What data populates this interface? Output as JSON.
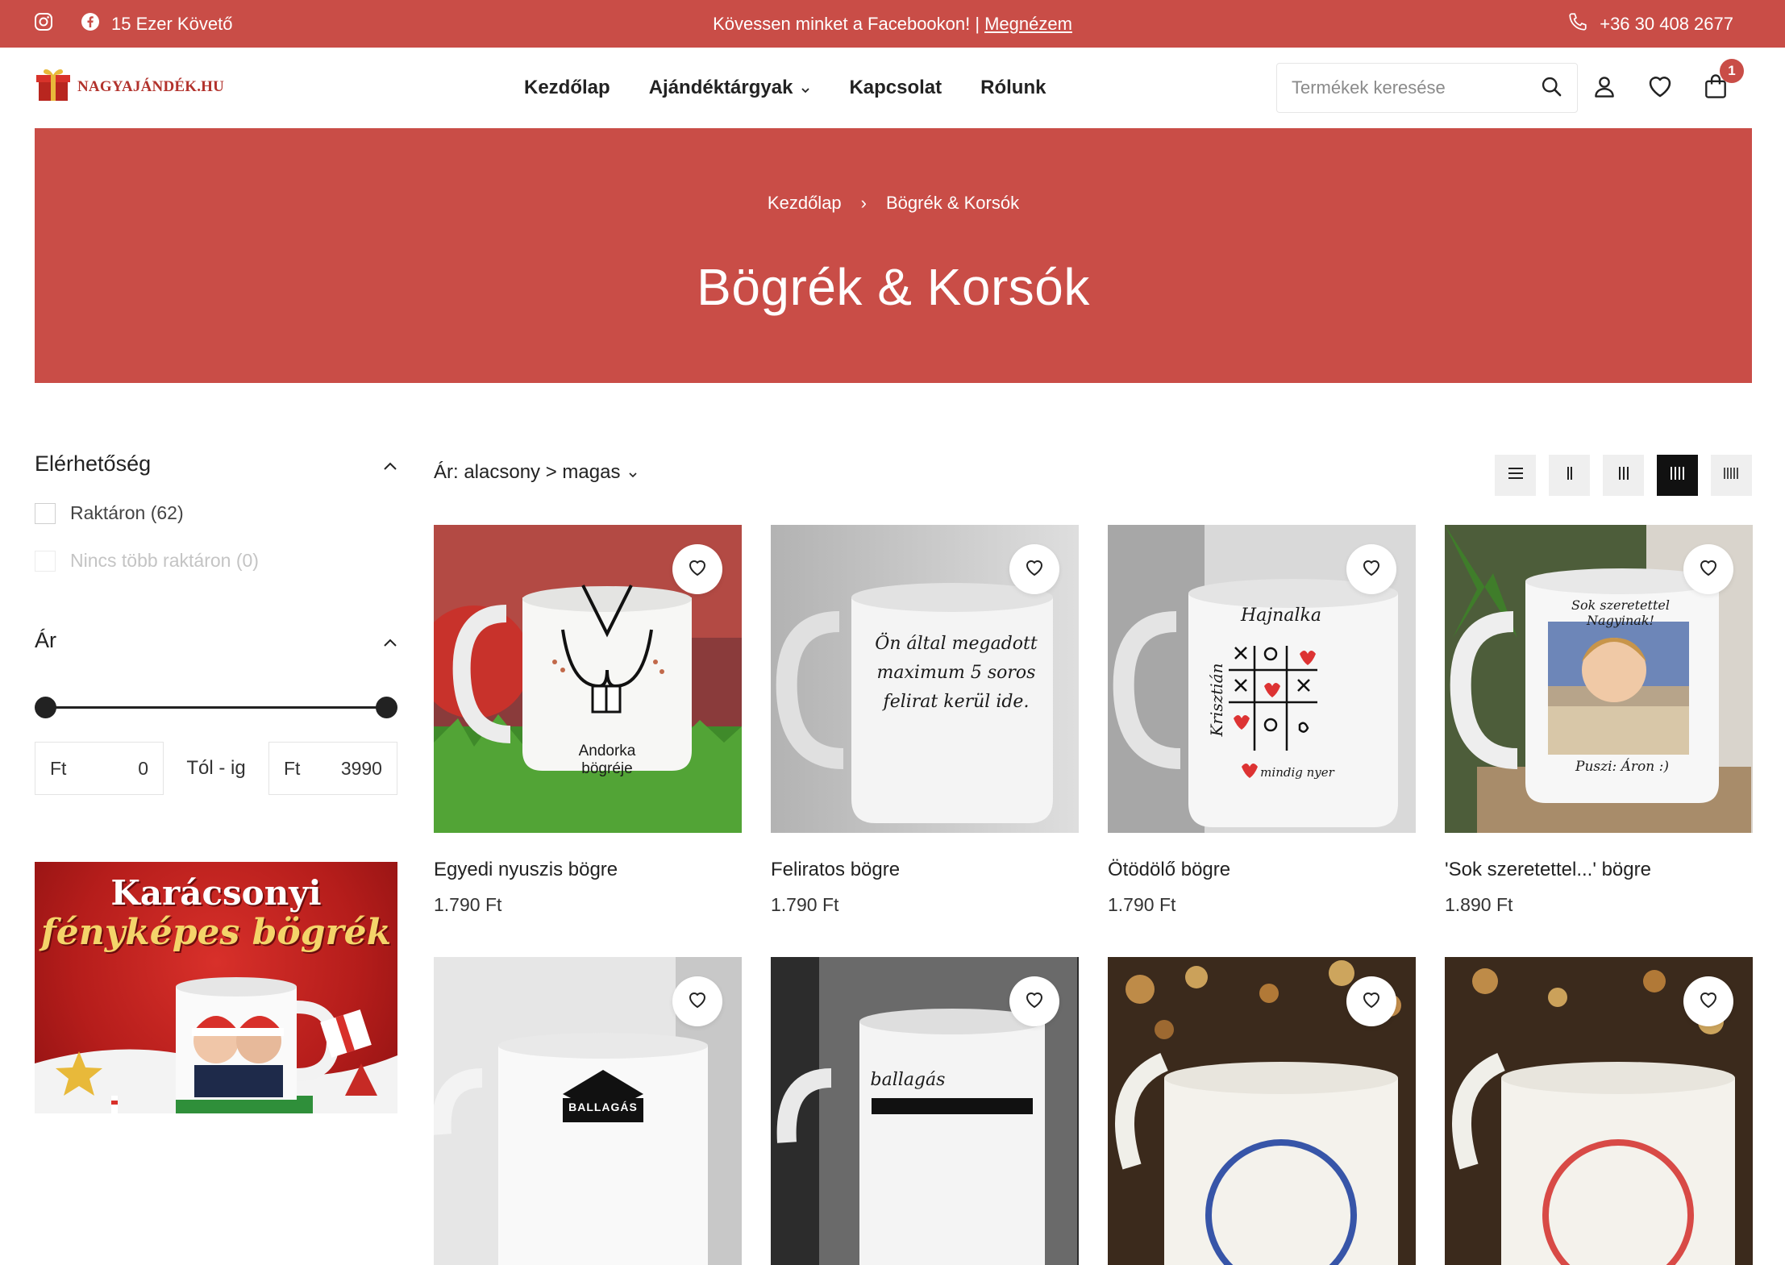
{
  "topbar": {
    "followers": "15 Ezer Követő",
    "promo_text": "Kövessen minket a Facebookon! |",
    "promo_link": "Megnézem",
    "phone": "+36 30 408 2677"
  },
  "header": {
    "logo_text": "NAGYAJÁNDÉK.HU",
    "nav": [
      "Kezdőlap",
      "Ajándéktárgyak",
      "Kapcsolat",
      "Rólunk"
    ],
    "search_placeholder": "Termékek keresése",
    "cart_count": "1"
  },
  "hero": {
    "breadcrumb_home": "Kezdőlap",
    "breadcrumb_sep": "›",
    "breadcrumb_current": "Bögrék & Korsók",
    "title": "Bögrék & Korsók"
  },
  "filters": {
    "availability_title": "Elérhetőség",
    "in_stock": "Raktáron (62)",
    "out_of_stock": "Nincs több raktáron (0)",
    "price_title": "Ár",
    "price_min_currency": "Ft",
    "price_min": "0",
    "range_label": "Tól - ig",
    "price_max_currency": "Ft",
    "price_max": "3990"
  },
  "banner": {
    "line1": "Karácsonyi",
    "line2": "fényképes bögrék"
  },
  "toolbar": {
    "sort_label": "Ár: alacsony > magas"
  },
  "products": [
    {
      "name": "Egyedi nyuszis bögre",
      "price": "1.790 Ft",
      "mug_text": "Andorka bögréje"
    },
    {
      "name": "Feliratos bögre",
      "price": "1.790 Ft",
      "mug_text": "Ön által megadott maximum 5 soros felirat kerül ide."
    },
    {
      "name": "Ötödölő bögre",
      "price": "1.790 Ft",
      "mug_title": "Hajnalka",
      "mug_side": "Krisztián",
      "mug_bottom": "mindig nyer"
    },
    {
      "name": "'Sok szeretettel...' bögre",
      "price": "1.890 Ft",
      "mug_top": "Sok szeretettel Nagyinak!",
      "mug_bottom": "Puszi: Áron :)"
    }
  ],
  "row2_labels": {
    "mug2": "ballagás",
    "mug1": "BALLAGÁS"
  },
  "colors": {
    "brand_red": "#c94d47",
    "text_dark": "#222222"
  }
}
